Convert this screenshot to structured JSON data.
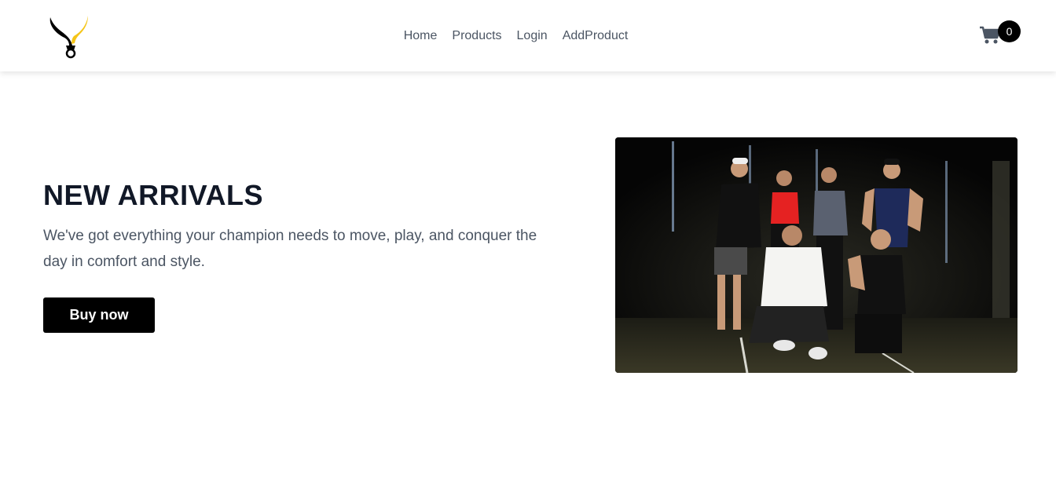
{
  "nav": {
    "links": [
      "Home",
      "Products",
      "Login",
      "AddProduct"
    ],
    "cart_count": "0",
    "logo_icon": "bull-logo-icon",
    "cart_icon": "shopping-cart-icon"
  },
  "hero": {
    "title": "NEW ARRIVALS",
    "description": "We've got everything your champion needs to move, play, and conquer the day in comfort and style.",
    "button_label": "Buy now",
    "image_alt": "group of athletes in gym"
  },
  "colors": {
    "accent": "#f5c518",
    "button_bg": "#000000",
    "text_dark": "#111827",
    "text_muted": "#4b5563"
  }
}
